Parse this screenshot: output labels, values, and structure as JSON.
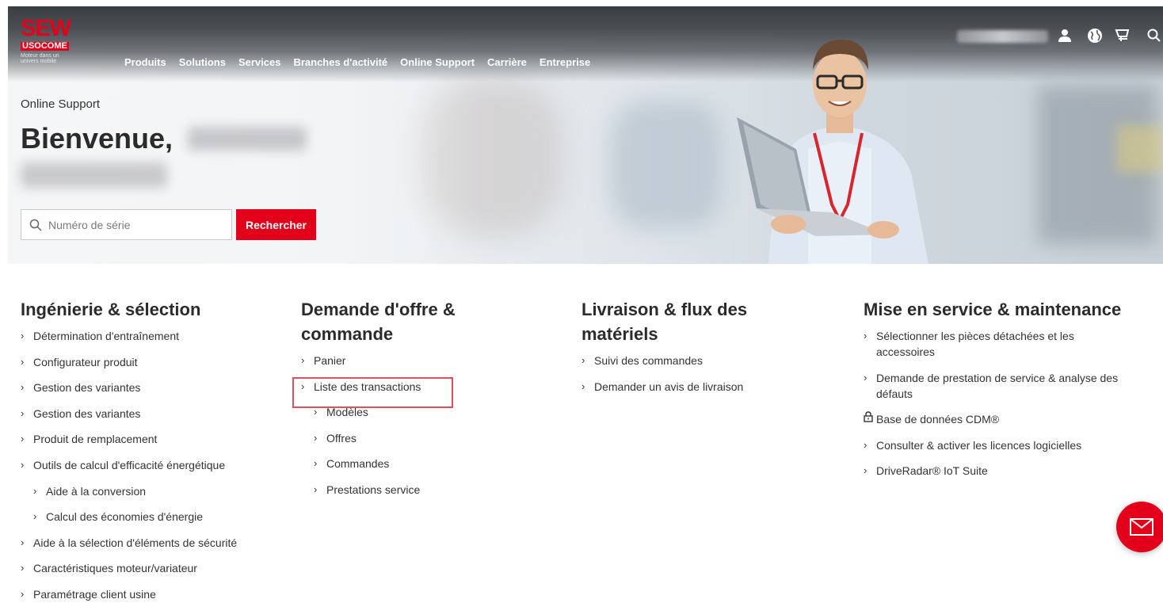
{
  "brand": {
    "logo_main": "SEW",
    "logo_sub": "USOCOME",
    "tagline": "Moteur dans un univers mobile",
    "accent_color": "#e3001b"
  },
  "nav": {
    "items": [
      "Produits",
      "Solutions",
      "Services",
      "Branches d'activité",
      "Online Support",
      "Carrière",
      "Entreprise"
    ]
  },
  "topbar": {
    "icons": [
      "user-icon",
      "globe-icon",
      "cart-icon",
      "search-icon"
    ]
  },
  "hero": {
    "breadcrumb": "Online Support",
    "welcome": "Bienvenue,",
    "search_placeholder": "Numéro de série",
    "search_button": "Rechercher"
  },
  "columns": [
    {
      "title": "Ingénierie & sélection",
      "items": [
        {
          "label": "Détermination d'entraînement",
          "level": 0
        },
        {
          "label": "Configurateur produit",
          "level": 0
        },
        {
          "label": "Gestion des variantes",
          "level": 0
        },
        {
          "label": "Gestion des variantes",
          "level": 0
        },
        {
          "label": "Produit de remplacement",
          "level": 0
        },
        {
          "label": "Outils de calcul d'efficacité énergétique",
          "level": 0
        },
        {
          "label": "Aide à la conversion",
          "level": 1
        },
        {
          "label": "Calcul des économies d'énergie",
          "level": 1
        },
        {
          "label": "Aide à la sélection d'éléments de sécurité",
          "level": 0
        },
        {
          "label": "Caractéristiques moteur/variateur",
          "level": 0
        },
        {
          "label": "Paramétrage client usine",
          "level": 0
        }
      ]
    },
    {
      "title": "Demande d'offre & commande",
      "items": [
        {
          "label": "Panier",
          "level": 0
        },
        {
          "label": "Liste des transactions",
          "level": 0
        },
        {
          "label": "Modèles",
          "level": 1
        },
        {
          "label": "Offres",
          "level": 1
        },
        {
          "label": "Commandes",
          "level": 1
        },
        {
          "label": "Prestations service",
          "level": 1
        }
      ]
    },
    {
      "title": "Livraison & flux des matériels",
      "items": [
        {
          "label": "Suivi des commandes",
          "level": 0
        },
        {
          "label": "Demander un avis de livraison",
          "level": 0
        }
      ]
    },
    {
      "title": "Mise en service & maintenance",
      "items": [
        {
          "label": "Sélectionner les pièces détachées et les accessoires",
          "level": 0
        },
        {
          "label": "Demande de prestation de service & analyse des défauts",
          "level": 0
        },
        {
          "label": "Base de données CDM®",
          "level": 0,
          "icon": "lock-icon"
        },
        {
          "label": "Consulter & activer les licences logicielles",
          "level": 0
        },
        {
          "label": "DriveRadar® IoT Suite",
          "level": 0
        }
      ]
    }
  ],
  "fab": {
    "icon": "mail-icon"
  }
}
